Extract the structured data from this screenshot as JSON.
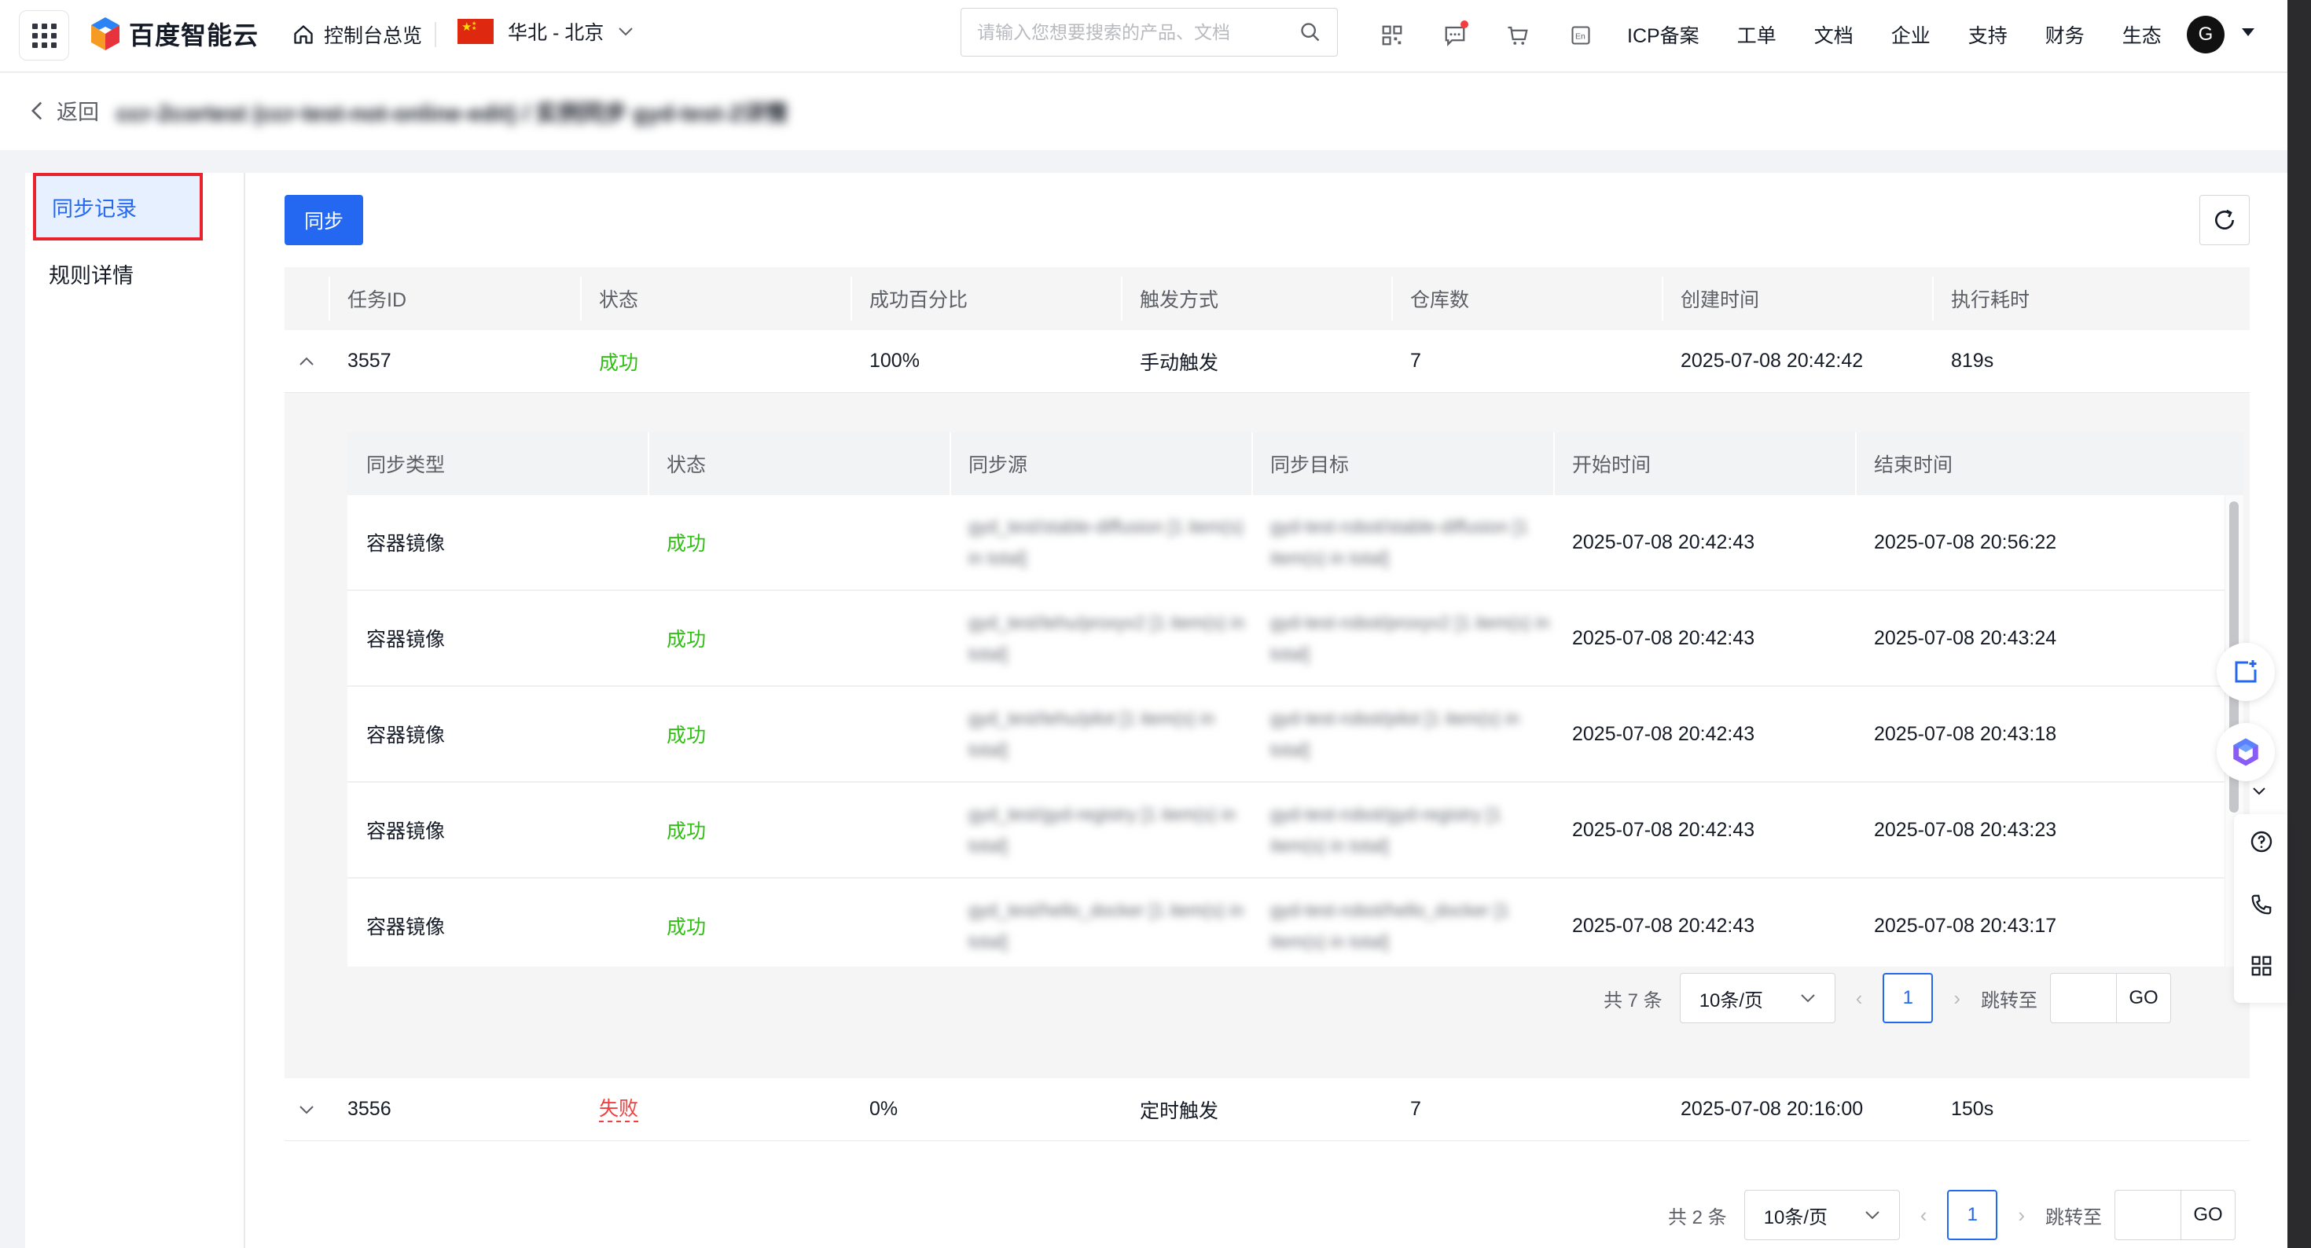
{
  "topbar": {
    "brand": "百度智能云",
    "console": "控制台总览",
    "region": "华北 - 北京",
    "search_placeholder": "请输入您想要搜索的产品、文档",
    "menu": [
      "ICP备案",
      "工单",
      "文档",
      "企业",
      "支持",
      "财务",
      "生态"
    ],
    "avatar_letter": "G",
    "icons": [
      "qrcode-icon",
      "message-icon",
      "cart-icon",
      "language-icon"
    ]
  },
  "breadcrumb": {
    "back_label": "返回",
    "path": "ccr-2cortest (ccr-test-not-online-edit) / 实例同步 gyd-test-2详情"
  },
  "sidenav": {
    "items": [
      {
        "label": "同步记录",
        "active": true
      },
      {
        "label": "规则详情",
        "active": false
      }
    ]
  },
  "toolbar": {
    "sync_label": "同步"
  },
  "outer_table": {
    "headers": [
      "任务ID",
      "状态",
      "成功百分比",
      "触发方式",
      "仓库数",
      "创建时间",
      "执行耗时"
    ],
    "rows": [
      {
        "id": "3557",
        "status": "成功",
        "status_type": "success",
        "percent": "100%",
        "trigger": "手动触发",
        "repos": "7",
        "created": "2025-07-08 20:42:42",
        "duration": "819s",
        "expanded": true
      },
      {
        "id": "3556",
        "status": "失败",
        "status_type": "fail",
        "percent": "0%",
        "trigger": "定时触发",
        "repos": "7",
        "created": "2025-07-08 20:16:00",
        "duration": "150s",
        "expanded": false
      }
    ],
    "pager": {
      "total": "共 2 条",
      "page_size": "10条/页",
      "page": "1",
      "jump_label": "跳转至",
      "go": "GO"
    }
  },
  "inner_table": {
    "headers": [
      "同步类型",
      "状态",
      "同步源",
      "同步目标",
      "开始时间",
      "结束时间"
    ],
    "rows": [
      {
        "type": "容器镜像",
        "status": "成功",
        "source": "gyd_test/stable-diffusion [1 item(s) in total]",
        "target": "gyd-test-robot/stable-diffusion [1 item(s) in total]",
        "start": "2025-07-08 20:42:43",
        "end": "2025-07-08 20:56:22"
      },
      {
        "type": "容器镜像",
        "status": "成功",
        "source": "gyd_test/tehu/proxyv2 [1 item(s) in total]",
        "target": "gyd-test-robot/proxyv2 [1 item(s) in total]",
        "start": "2025-07-08 20:42:43",
        "end": "2025-07-08 20:43:24"
      },
      {
        "type": "容器镜像",
        "status": "成功",
        "source": "gyd_test/tehu/pilot [1 item(s) in total]",
        "target": "gyd-test-robot/pilot [1 item(s) in total]",
        "start": "2025-07-08 20:42:43",
        "end": "2025-07-08 20:43:18"
      },
      {
        "type": "容器镜像",
        "status": "成功",
        "source": "gyd_test/gyd-registry [1 item(s) in total]",
        "target": "gyd-test-robot/gyd-registry [1 item(s) in total]",
        "start": "2025-07-08 20:42:43",
        "end": "2025-07-08 20:43:23"
      },
      {
        "type": "容器镜像",
        "status": "成功",
        "source": "gyd_test/hello_docker [1 item(s) in total]",
        "target": "gyd-test-robot/hello_docker [1 item(s) in total]",
        "start": "2025-07-08 20:42:43",
        "end": "2025-07-08 20:43:17"
      }
    ],
    "pager": {
      "total": "共 7 条",
      "page_size": "10条/页",
      "page": "1",
      "jump_label": "跳转至",
      "go": "GO"
    }
  },
  "colors": {
    "primary": "#2468f2",
    "success": "#30bf13",
    "fail": "#f33e3e",
    "highlight_box": "#e8232e"
  }
}
